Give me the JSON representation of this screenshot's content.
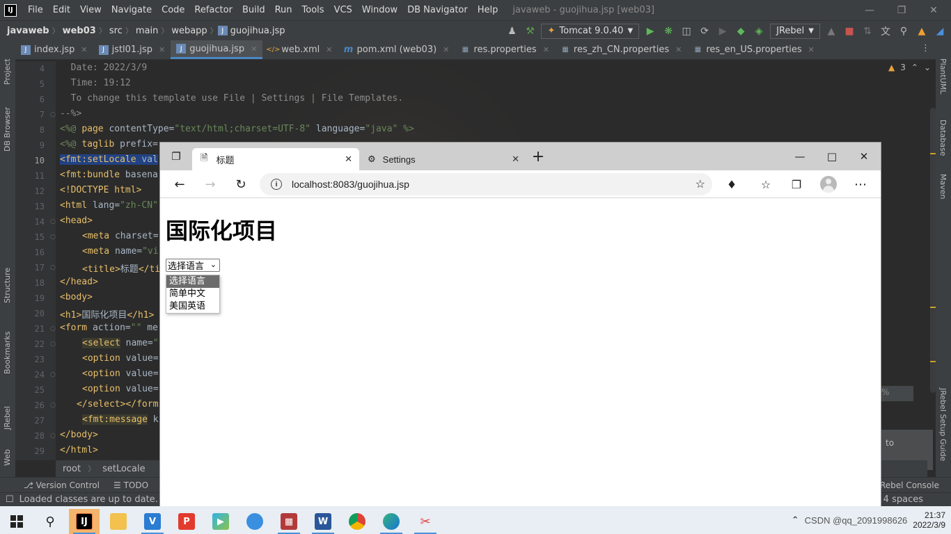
{
  "ide": {
    "menu": [
      "File",
      "Edit",
      "View",
      "Navigate",
      "Code",
      "Refactor",
      "Build",
      "Run",
      "Tools",
      "VCS",
      "Window",
      "DB Navigator",
      "Help"
    ],
    "window_title": "javaweb - guojihua.jsp [web03]",
    "breadcrumb": [
      "javaweb",
      "web03",
      "src",
      "main",
      "webapp",
      "guojihua.jsp"
    ],
    "run_config": "Tomcat 9.0.40",
    "jrebel_label": "JRebel",
    "tabs": [
      {
        "label": "index.jsp",
        "icon": "jsp-file-icon",
        "active": false
      },
      {
        "label": "jstl01.jsp",
        "icon": "jsp-file-icon",
        "active": false
      },
      {
        "label": "guojihua.jsp",
        "icon": "jsp-file-icon",
        "active": true
      },
      {
        "label": "web.xml",
        "icon": "xml-file-icon",
        "active": false
      },
      {
        "label": "pom.xml (web03)",
        "icon": "maven-file-icon",
        "active": false
      },
      {
        "label": "res.properties",
        "icon": "properties-file-icon",
        "active": false
      },
      {
        "label": "res_zh_CN.properties",
        "icon": "properties-file-icon",
        "active": false
      },
      {
        "label": "res_en_US.properties",
        "icon": "properties-file-icon",
        "active": false
      }
    ],
    "left_tools": [
      "Project",
      "DB Browser",
      "Structure",
      "Bookmarks",
      "JRebel",
      "Web"
    ],
    "right_tools": [
      "PlantUML",
      "Database",
      "Maven",
      "JRebel Setup Guide"
    ],
    "warnings": "3",
    "line_numbers": [
      "4",
      "5",
      "6",
      "7",
      "8",
      "9",
      "10",
      "11",
      "12",
      "13",
      "14",
      "15",
      "16",
      "17",
      "18",
      "19",
      "20",
      "21",
      "22",
      "23",
      "24",
      "25",
      "26",
      "27",
      "28",
      "29"
    ],
    "current_line": "10",
    "code": {
      "l4": "  Date: 2022/3/9",
      "l5": "  Time: 19:12",
      "l6": "  To change this template use File | Settings | File Templates.",
      "l7": "--%>",
      "l8a": "<%@ ",
      "l8b": "page ",
      "l8c": "contentType=",
      "l8d": "\"text/html;charset=UTF-8\"",
      "l8e": " language=",
      "l8f": "\"java\"",
      "l8g": " %>",
      "l9a": "<%@ ",
      "l9b": "taglib ",
      "l9c": "prefix=",
      "l10a": "<fmt:setLocale",
      "l10b": " val",
      "l11a": "<fmt:bundle",
      "l11b": " basena",
      "l12": "<!DOCTYPE html>",
      "l13a": "<html",
      "l13b": " lang=",
      "l13c": "\"zh-CN\"",
      "l14": "<head>",
      "l15a": "<meta",
      "l15b": " charset=",
      "l16a": "<meta",
      "l16b": " name=",
      "l16c": "\"vi",
      "l17a": "<title>",
      "l17b": "标题",
      "l17c": "</ti",
      "l18": "</head>",
      "l19": "<body>",
      "l20a": "<h1>",
      "l20b": "国际化项目",
      "l20c": "</h1>",
      "l21a": "<form",
      "l21b": " action=",
      "l21c": "\"\"",
      "l21d": " me",
      "l22a": "<select",
      "l22b": " name=",
      "l22c": "\"",
      "l23a": "<option",
      "l23b": " value=",
      "l24a": "<option",
      "l24b": " value=",
      "l25a": "<option",
      "l25b": " value=",
      "l26a": "</select>",
      "l26b": "</form",
      "l27a": "<fmt:message",
      "l27b": " k",
      "l28": "</body>",
      "l29": "</html>"
    },
    "editor_crumbs": [
      "root",
      "setLocale"
    ],
    "bottom_tools": [
      "Version Control",
      "TODO"
    ],
    "jrebel_console": "Rebel Console",
    "status_text": "Loaded classes are up to date. No",
    "status_right": "4 spaces",
    "notif_fragment": "to",
    "side_fragment": "%"
  },
  "browser": {
    "tabs": [
      {
        "label": "标题",
        "icon": "page-icon",
        "active": true
      },
      {
        "label": "Settings",
        "icon": "gear-icon",
        "active": false
      }
    ],
    "url": "localhost:8083/guojihua.jsp",
    "page": {
      "heading": "国际化项目",
      "select_value": "选择语言",
      "options": [
        "选择语言",
        "简单中文",
        "美国英语"
      ],
      "highlighted_option": 0
    }
  },
  "taskbar": {
    "apps": [
      "intellij",
      "file-explorer",
      "vscode",
      "wps-pdf",
      "media-player",
      "browser-360",
      "winrar",
      "word",
      "chrome",
      "edge",
      "snipping-tool"
    ],
    "clock_time": "21:37",
    "clock_date": "2022/3/9",
    "watermark": "CSDN @qq_2091998626"
  },
  "colors": {
    "ide_bg": "#2b2b2b",
    "ide_panel": "#3c3f41",
    "tag": "#e8bf6a",
    "string": "#6a8759",
    "selection": "#214283",
    "accent": "#4a88c7"
  }
}
